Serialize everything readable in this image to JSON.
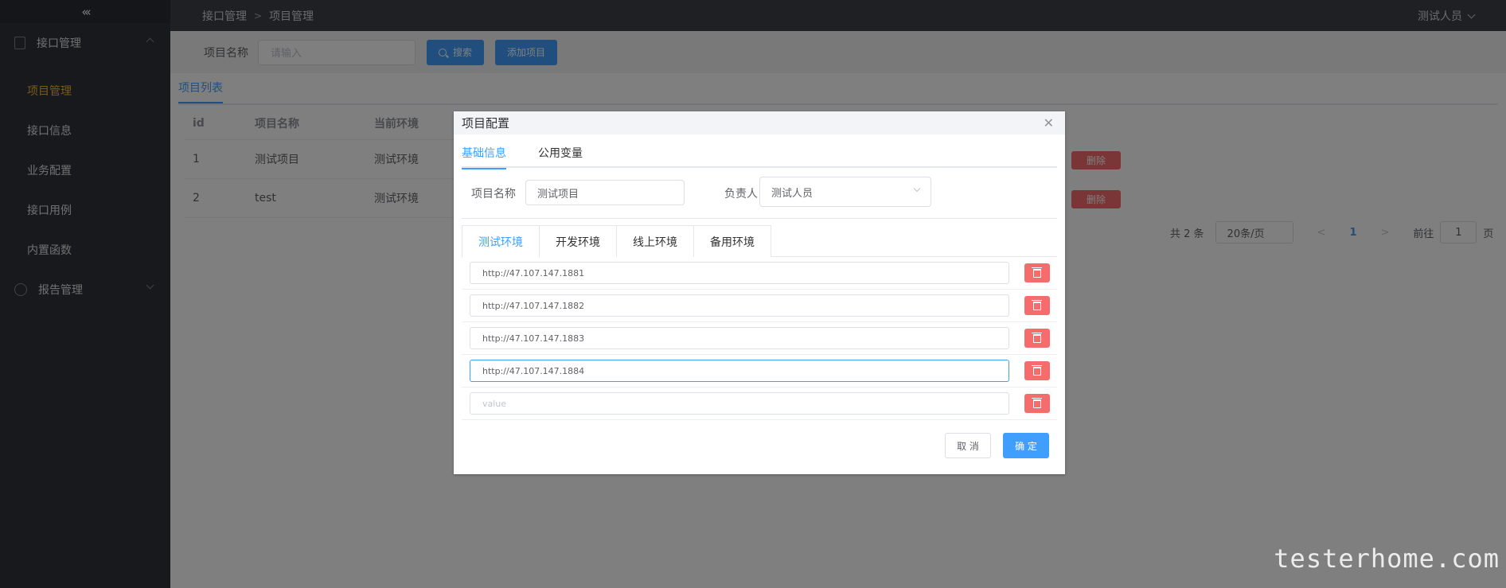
{
  "sidebar": {
    "collapse_glyph": "«‹",
    "groups": [
      {
        "label": "接口管理",
        "icon": "document-icon",
        "expanded": true
      },
      {
        "label": "报告管理",
        "icon": "clock-icon",
        "expanded": false
      }
    ],
    "items": [
      {
        "label": "项目管理",
        "active": true
      },
      {
        "label": "接口信息"
      },
      {
        "label": "业务配置"
      },
      {
        "label": "接口用例"
      },
      {
        "label": "内置函数"
      }
    ]
  },
  "header": {
    "breadcrumb": [
      "接口管理",
      "项目管理"
    ],
    "user": "测试人员"
  },
  "toolbar": {
    "label": "项目名称",
    "placeholder": "请输入",
    "search_label": "搜索",
    "add_label": "添加项目"
  },
  "tabs": [
    "项目列表"
  ],
  "table": {
    "headers": [
      "id",
      "项目名称",
      "当前环境"
    ],
    "rows": [
      {
        "id": "1",
        "name": "测试项目",
        "env": "测试环境"
      },
      {
        "id": "2",
        "name": "test",
        "env": "测试环境"
      }
    ],
    "delete_label": "删除"
  },
  "pagination": {
    "total": "共 2 条",
    "page_size": "20条/页",
    "current": "1",
    "goto_prefix": "前往",
    "goto_value": "1",
    "goto_suffix": "页"
  },
  "dialog": {
    "title": "项目配置",
    "tabs": [
      "基础信息",
      "公用变量"
    ],
    "name_label": "项目名称",
    "name_value": "测试项目",
    "owner_label": "负责人",
    "owner_value": "测试人员",
    "env_tabs": [
      "测试环境",
      "开发环境",
      "线上环境",
      "备用环境"
    ],
    "env_values": [
      "http://47.107.147.1881",
      "http://47.107.147.1882",
      "http://47.107.147.1883",
      "http://47.107.147.1884"
    ],
    "env_placeholder": "value",
    "cancel_label": "取 消",
    "ok_label": "确 定"
  },
  "watermark": "testerhome.com",
  "colors": {
    "primary": "#409eff",
    "danger": "#f56c6c",
    "sidebar_bg": "#30333a",
    "active_menu": "#f0b433"
  }
}
